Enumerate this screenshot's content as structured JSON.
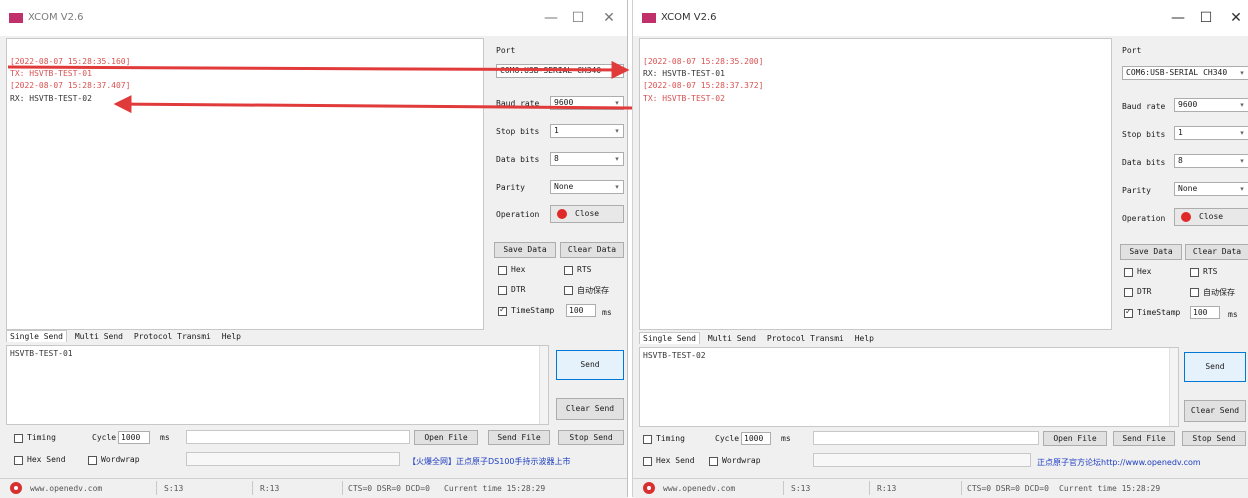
{
  "windows": [
    {
      "title": "XCOM V2.6",
      "controls": {
        "minimize": "—",
        "maximize": "☐",
        "close": "✕"
      },
      "receive_lines": [
        {
          "kind": "ts",
          "text": "[2022-08-07 15:28:35.160]"
        },
        {
          "kind": "tx",
          "text": "TX: HSVTB-TEST-01"
        },
        {
          "kind": "ts",
          "text": "[2022-08-07 15:28:37.407]"
        },
        {
          "kind": "rx",
          "text": "RX: HSVTB-TEST-02"
        }
      ],
      "panel": {
        "port_label": "Port",
        "port_value": "COM6:USB-SERIAL CH340",
        "baud_label": "Baud rate",
        "baud_value": "9600",
        "stop_label": "Stop bits",
        "stop_value": "1",
        "data_label": "Data bits",
        "data_value": "8",
        "parity_label": "Parity",
        "parity_value": "None",
        "operation_label": "Operation",
        "close_label": "Close",
        "save_data": "Save Data",
        "clear_data": "Clear Data",
        "hex_label": "Hex",
        "rts_label": "RTS",
        "dtr_label": "DTR",
        "auto_save_label": "自动保存",
        "timestamp_label": "TimeStamp",
        "timestamp_value": "100",
        "ms_label": "ms"
      },
      "tabs": [
        "Single Send",
        "Multi Send",
        "Protocol Transmi",
        "Help"
      ],
      "send_text": "HSVTB-TEST-01",
      "send_button": "Send",
      "clear_send_button": "Clear Send",
      "timing_label": "Timing",
      "cycle_label": "Cycle",
      "cycle_value": "1000",
      "cycle_unit": "ms",
      "hex_send_label": "Hex Send",
      "wordwrap_label": "Wordwrap",
      "open_file": "Open File",
      "send_file": "Send File",
      "stop_send": "Stop Send",
      "notice": "【火爆全网】正点原子DS100手持示波器上市",
      "status": {
        "website": "www.openedv.com",
        "s_count": "S:13",
        "r_count": "R:13",
        "lines": "CTS=0 DSR=0 DCD=0",
        "time": "Current time 15:28:29"
      }
    },
    {
      "title": "XCOM V2.6",
      "controls": {
        "minimize": "—",
        "maximize": "☐",
        "close": "✕"
      },
      "receive_lines": [
        {
          "kind": "ts",
          "text": "[2022-08-07 15:28:35.200]"
        },
        {
          "kind": "rx",
          "text": "RX: HSVTB-TEST-01"
        },
        {
          "kind": "ts",
          "text": "[2022-08-07 15:28:37.372]"
        },
        {
          "kind": "tx",
          "text": "TX: HSVTB-TEST-02"
        }
      ],
      "panel": {
        "port_label": "Port",
        "port_value": "COM6:USB-SERIAL CH340",
        "baud_label": "Baud rate",
        "baud_value": "9600",
        "stop_label": "Stop bits",
        "stop_value": "1",
        "data_label": "Data bits",
        "data_value": "8",
        "parity_label": "Parity",
        "parity_value": "None",
        "operation_label": "Operation",
        "close_label": "Close",
        "save_data": "Save Data",
        "clear_data": "Clear Data",
        "hex_label": "Hex",
        "rts_label": "RTS",
        "dtr_label": "DTR",
        "auto_save_label": "自动保存",
        "timestamp_label": "TimeStamp",
        "timestamp_value": "100",
        "ms_label": "ms"
      },
      "tabs": [
        "Single Send",
        "Multi Send",
        "Protocol Transmi",
        "Help"
      ],
      "send_text": "HSVTB-TEST-02",
      "send_button": "Send",
      "clear_send_button": "Clear Send",
      "timing_label": "Timing",
      "cycle_label": "Cycle",
      "cycle_value": "1000",
      "cycle_unit": "ms",
      "hex_send_label": "Hex Send",
      "wordwrap_label": "Wordwrap",
      "open_file": "Open File",
      "send_file": "Send File",
      "stop_send": "Stop Send",
      "notice": "正点原子官方论坛http://www.openedv.com",
      "status": {
        "website": "www.openedv.com",
        "s_count": "S:13",
        "r_count": "R:13",
        "lines": "CTS=0 DSR=0 DCD=0",
        "time": "Current time 15:28:29"
      }
    }
  ],
  "colors": {
    "arrow": "#e03a3a",
    "title_logo": "#c0306a",
    "status_icon": "#d83030"
  }
}
